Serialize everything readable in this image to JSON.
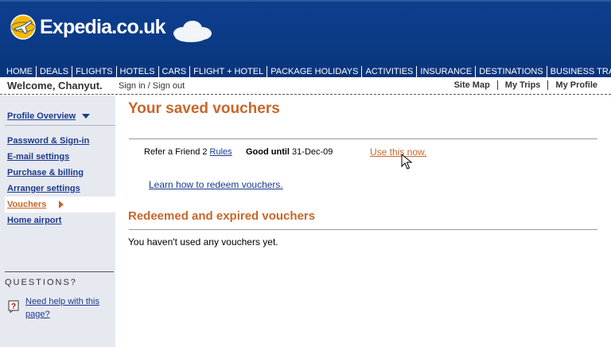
{
  "header": {
    "logo_text": "Expedia.co.uk",
    "nav": [
      "HOME",
      "DEALS",
      "FLIGHTS",
      "HOTELS",
      "CARS",
      "FLIGHT + HOTEL",
      "PACKAGE HOLIDAYS",
      "ACTIVITIES",
      "INSURANCE",
      "DESTINATIONS",
      "BUSINESS TRAVEL"
    ]
  },
  "welcome_bar": {
    "welcome": "Welcome, Chanyut.",
    "sign_in_out": "Sign in / Sign out",
    "links": [
      "Site Map",
      "My Trips",
      "My Profile"
    ]
  },
  "sidebar": {
    "profile_overview": "Profile Overview",
    "items": [
      {
        "label": "Password & Sign-in"
      },
      {
        "label": "E-mail settings"
      },
      {
        "label": "Purchase & billing"
      },
      {
        "label": "Arranger settings"
      },
      {
        "label": "Vouchers",
        "active": true
      },
      {
        "label": "Home airport"
      }
    ],
    "questions_label": "QUESTIONS?",
    "help_link": "Need help with this page?"
  },
  "main": {
    "title": "Your saved vouchers",
    "voucher": {
      "name": "Refer a Friend 2",
      "rules_label": "Rules",
      "good_until_label": "Good until",
      "good_until_date": "31-Dec-09",
      "use_label": "Use this now."
    },
    "learn_link": "Learn how to redeem vouchers.",
    "redeemed_title": "Redeemed and expired vouchers",
    "no_vouchers_text": "You haven't used any vouchers yet."
  },
  "colors": {
    "header_blue": "#0b3a86",
    "accent_orange": "#c8662a",
    "link_blue": "#1a3a8e",
    "sidebar_bg": "#e7e9f1"
  }
}
